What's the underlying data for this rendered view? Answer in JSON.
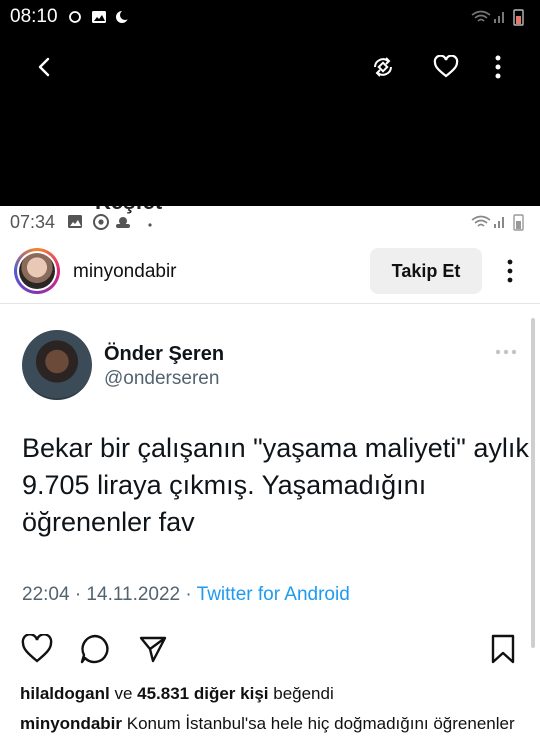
{
  "outer_status": {
    "time": "08:10",
    "icons": [
      "sync-icon",
      "image-icon",
      "moon-icon"
    ],
    "system_icons": [
      "wifi-icon",
      "signal-icon",
      "battery-icon"
    ]
  },
  "viewer": {
    "icons": [
      "back-arrow-icon",
      "rotate-icon",
      "heart-icon",
      "more-vertical-icon"
    ]
  },
  "inner_status": {
    "time": "07:34",
    "ghost_title": "Keşfet"
  },
  "post": {
    "username": "minyondabir",
    "follow_label": "Takip Et"
  },
  "tweet": {
    "name": "Önder Şeren",
    "handle": "@onderseren",
    "text": "Bekar bir çalışanın \"yaşama maliyeti\" aylık 9.705 liraya çıkmış. Yaşamadığını öğrenenler fav",
    "time": "22:04 · 14.11.2022 · ",
    "source": "Twitter for Android"
  },
  "engagement": {
    "liker": "hilaldoganl",
    "and": " ve ",
    "others": "45.831 diğer kişi",
    "liked": " beğendi"
  },
  "caption": {
    "username": "minyondabir",
    "text": " Konum İstanbul'sa hele hiç doğmadığını öğrenenler"
  },
  "colors": {
    "link_blue": "#1d9bf0",
    "muted": "#536471",
    "follow_bg": "#efefef"
  }
}
